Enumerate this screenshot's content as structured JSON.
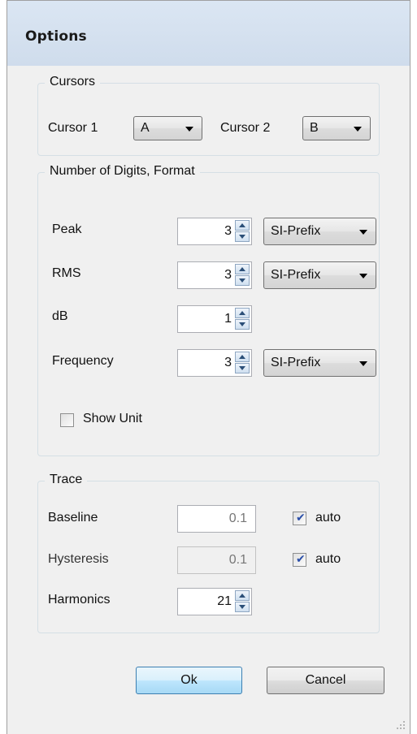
{
  "window": {
    "title": "Options"
  },
  "cursors": {
    "legend": "Cursors",
    "cursor1_label": "Cursor 1",
    "cursor1_value": "A",
    "cursor2_label": "Cursor 2",
    "cursor2_value": "B"
  },
  "digits": {
    "legend": "Number of Digits, Format",
    "rows": [
      {
        "label": "Peak",
        "digits": "3",
        "format": "SI-Prefix"
      },
      {
        "label": "RMS",
        "digits": "3",
        "format": "SI-Prefix"
      },
      {
        "label": "dB",
        "digits": "1"
      },
      {
        "label": "Frequency",
        "digits": "3",
        "format": "SI-Prefix"
      }
    ],
    "show_unit_label": "Show Unit",
    "show_unit_checked": false
  },
  "trace": {
    "legend": "Trace",
    "baseline_label": "Baseline",
    "baseline_value": "0.1",
    "baseline_auto_label": "auto",
    "baseline_auto_checked": true,
    "hysteresis_label": "Hysteresis",
    "hysteresis_value": "0.1",
    "hysteresis_auto_label": "auto",
    "hysteresis_auto_checked": true,
    "harmonics_label": "Harmonics",
    "harmonics_value": "21"
  },
  "buttons": {
    "ok": "Ok",
    "cancel": "Cancel"
  },
  "icons": {
    "check": "✔"
  }
}
